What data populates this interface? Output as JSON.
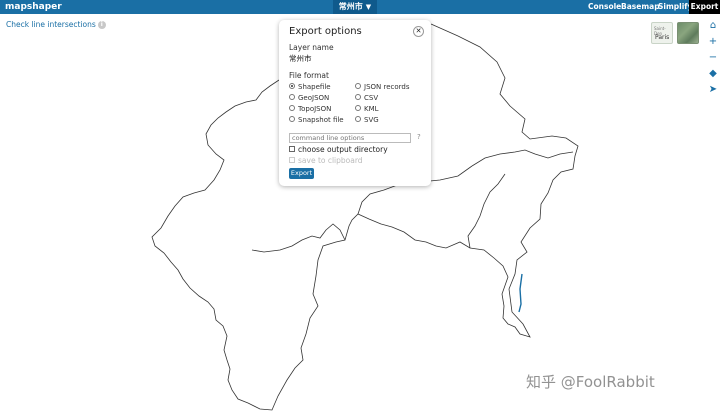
{
  "topbar": {
    "brand": "mapshaper",
    "layer_name": "常州市",
    "caret": "▼",
    "nav": {
      "console": "Console",
      "basemap": "Basemap",
      "simplify": "Simplify",
      "export": "Export"
    }
  },
  "check_intersections": {
    "label": "Check line intersections",
    "info": "i"
  },
  "basemap_thumbs": {
    "street": {
      "line1": "Saint-Den",
      "line2": "Paris"
    }
  },
  "tools": {
    "home": "⌂",
    "zoom_in": "+",
    "zoom_out": "−",
    "bookmark": "◆",
    "pointer": "➤"
  },
  "export_dialog": {
    "title": "Export options",
    "close": "✕",
    "layer_name_label": "Layer name",
    "layer_name_value": "常州市",
    "file_format_label": "File format",
    "formats_left": [
      "Shapefile",
      "GeoJSON",
      "TopoJSON",
      "Snapshot file"
    ],
    "formats_right": [
      "JSON records",
      "CSV",
      "KML",
      "SVG"
    ],
    "selected_format": "Shapefile",
    "command_placeholder": "command line options",
    "help": "?",
    "choose_output_dir": "choose output directory",
    "save_to_clipboard": "save to clipboard",
    "export_button": "Export"
  },
  "watermark": "知乎 @FoolRabbit",
  "colors": {
    "topbar": "#1a6fa5",
    "layer_select": "#0f5a8c",
    "active_tab": "#000000",
    "link": "#1a6fa5",
    "boundary_outline": "#333333",
    "river": "#1a6fa5"
  }
}
